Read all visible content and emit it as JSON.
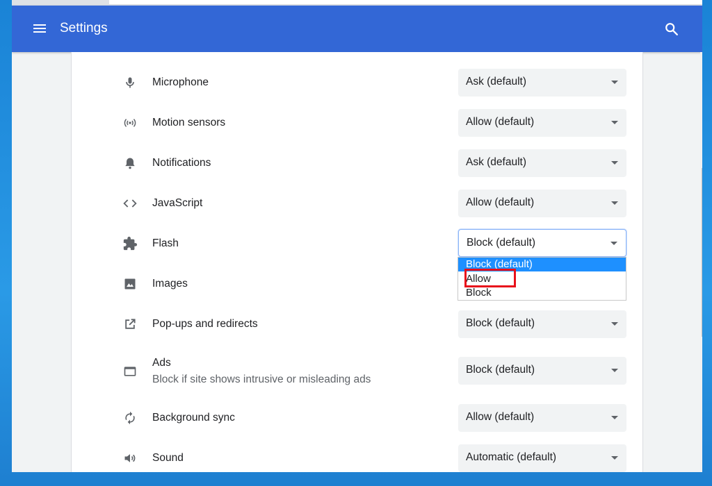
{
  "header": {
    "title": "Settings",
    "menu_icon": "hamburger-menu-icon",
    "search_icon": "search-icon"
  },
  "rows": [
    {
      "id": "microphone",
      "icon": "microphone-icon",
      "label": "Microphone",
      "value": "Ask (default)"
    },
    {
      "id": "motion-sensors",
      "icon": "motion-sensors-icon",
      "label": "Motion sensors",
      "value": "Allow (default)"
    },
    {
      "id": "notifications",
      "icon": "bell-icon",
      "label": "Notifications",
      "value": "Ask (default)"
    },
    {
      "id": "javascript",
      "icon": "code-icon",
      "label": "JavaScript",
      "value": "Allow (default)"
    },
    {
      "id": "flash",
      "icon": "puzzle-piece-icon",
      "label": "Flash",
      "value": "Block (default)"
    },
    {
      "id": "images",
      "icon": "image-icon",
      "label": "Images"
    },
    {
      "id": "popups",
      "icon": "open-in-new-icon",
      "label": "Pop-ups and redirects",
      "value": "Block (default)"
    },
    {
      "id": "ads",
      "icon": "web-window-icon",
      "label": "Ads",
      "sublabel": "Block if site shows intrusive or misleading ads",
      "value": "Block (default)"
    },
    {
      "id": "background-sync",
      "icon": "sync-icon",
      "label": "Background sync",
      "value": "Allow (default)"
    },
    {
      "id": "sound",
      "icon": "speaker-icon",
      "label": "Sound",
      "value": "Automatic (default)"
    }
  ],
  "flash_dropdown": {
    "options": [
      "Block (default)",
      "Allow",
      "Block"
    ],
    "selected": "Block (default)",
    "highlighted": "Allow",
    "highlight_color": "#e8101b"
  },
  "colors": {
    "header": "#3367d6",
    "select_bg": "#f1f3f4",
    "dropdown_selected": "#1e90ff"
  }
}
